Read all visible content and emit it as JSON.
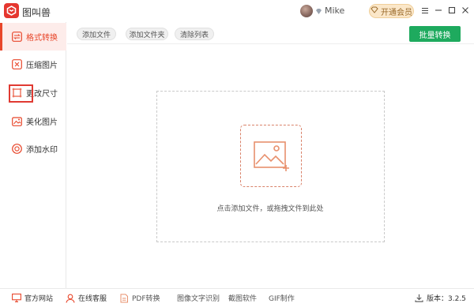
{
  "app": {
    "title": "图叫兽"
  },
  "user": {
    "name": "Mike"
  },
  "header": {
    "vip_label": "开通会员"
  },
  "sidebar": {
    "items": [
      {
        "label": "格式转换",
        "icon": "convert-icon"
      },
      {
        "label": "压缩图片",
        "icon": "compress-icon"
      },
      {
        "label": "更改尺寸",
        "icon": "resize-icon"
      },
      {
        "label": "美化图片",
        "icon": "beautify-icon"
      },
      {
        "label": "添加水印",
        "icon": "watermark-icon"
      }
    ]
  },
  "toolbar": {
    "add_file": "添加文件",
    "add_folder": "添加文件夹",
    "clear_list": "清除列表",
    "batch_convert": "批量转换"
  },
  "dropzone": {
    "hint": "点击添加文件，或拖拽文件到此处"
  },
  "footer": {
    "website": "官方网站",
    "support": "在线客服",
    "pdf": "PDF转换",
    "ocr": "图像文字识别",
    "screenshot": "截图软件",
    "gif": "GIF制作",
    "version": "版本：3.2.5"
  },
  "colors": {
    "accent": "#e8462a",
    "green": "#1eaa5e",
    "vip": "#fbe7c9"
  }
}
